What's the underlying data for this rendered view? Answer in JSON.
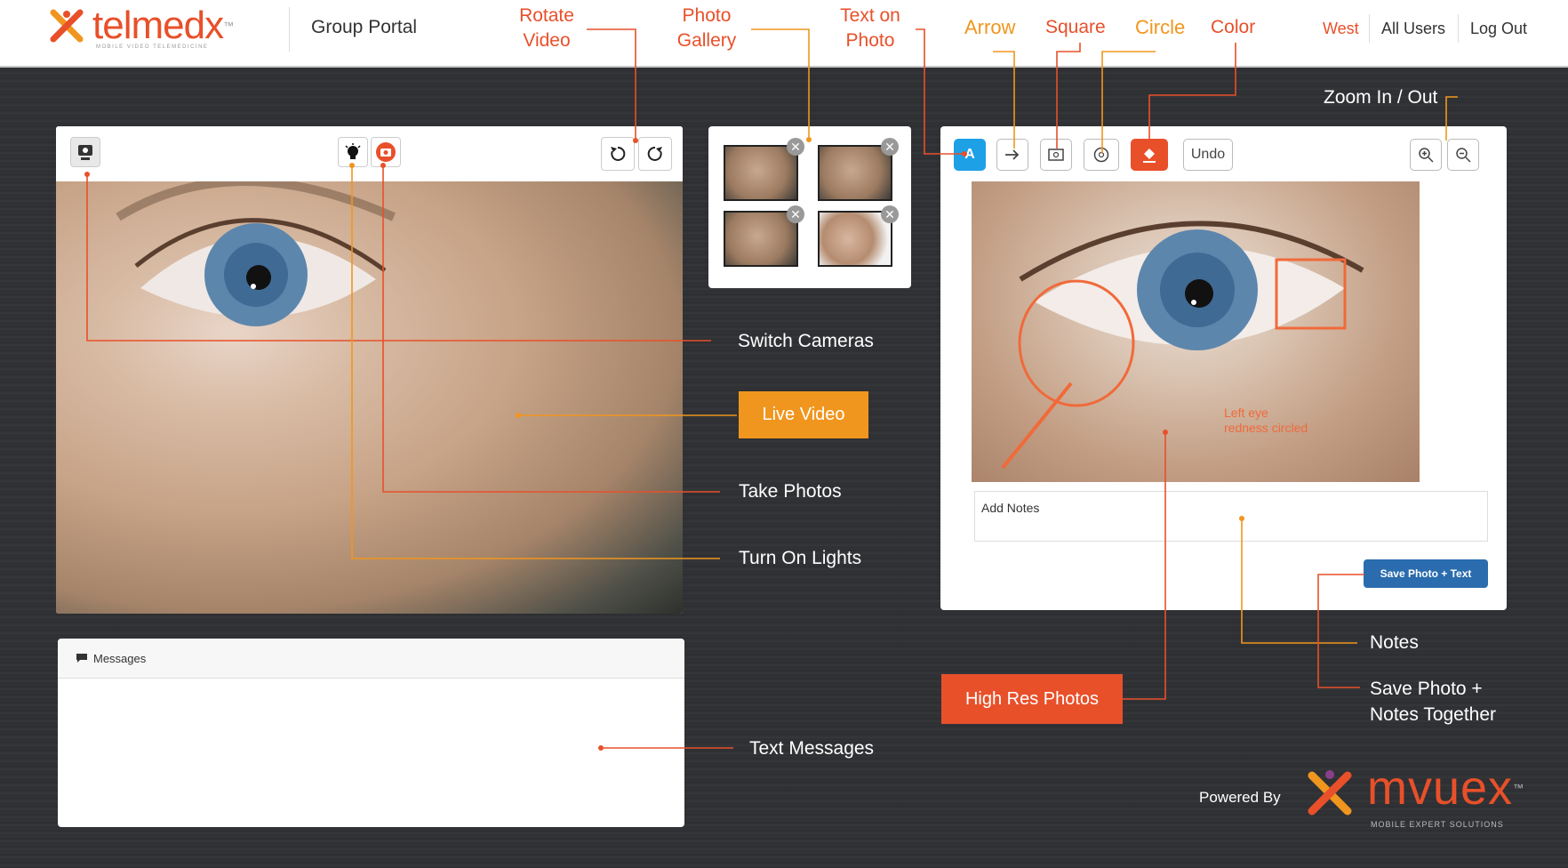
{
  "header": {
    "logo_name": "telmedx",
    "logo_tm": "™",
    "logo_tagline": "MOBILE VIDEO TELEMEDICINE",
    "portal_title": "Group Portal",
    "nav": {
      "region": "West",
      "users": "All Users",
      "logout": "Log Out"
    }
  },
  "callouts_top": {
    "rotate_video": [
      "Rotate",
      "Video"
    ],
    "photo_gallery": [
      "Photo",
      "Gallery"
    ],
    "text_on_photo": [
      "Text on",
      "Photo"
    ],
    "arrow": "Arrow",
    "square": "Square",
    "circle": "Circle",
    "color": "Color",
    "zoom": "Zoom In / Out"
  },
  "video_panel": {
    "icons": [
      "switch-camera-icon",
      "light-bulb-icon",
      "camera-icon",
      "rotate-left-icon",
      "rotate-right-icon"
    ]
  },
  "gallery": {
    "thumbnails": [
      "photo-1",
      "photo-2",
      "photo-3",
      "photo-4"
    ],
    "remove_glyph": "✕"
  },
  "photo_panel": {
    "tools": {
      "text": "A",
      "undo": "Undo"
    },
    "annotation_text": [
      "Left eye",
      "redness circled"
    ],
    "notes_placeholder": "Add Notes",
    "save_label": "Save Photo + Text"
  },
  "messages": {
    "title": "Messages"
  },
  "labels": {
    "switch_cameras": "Switch Cameras",
    "live_video": "Live Video",
    "take_photos": "Take Photos",
    "turn_on_lights": "Turn On Lights",
    "text_messages": "Text Messages",
    "high_res_photos": "High Res Photos",
    "notes": "Notes",
    "save_photo_notes": [
      "Save Photo +",
      "Notes Together"
    ]
  },
  "footer": {
    "powered_by": "Powered By",
    "brand": "mvuex",
    "brand_tagline": "MOBILE EXPERT SOLUTIONS",
    "brand_tm": "™"
  },
  "colors": {
    "brand_orange": "#e8502a",
    "callout_amber": "#f0961e",
    "accent_blue": "#1ea0e6",
    "save_blue": "#2a6cad"
  }
}
